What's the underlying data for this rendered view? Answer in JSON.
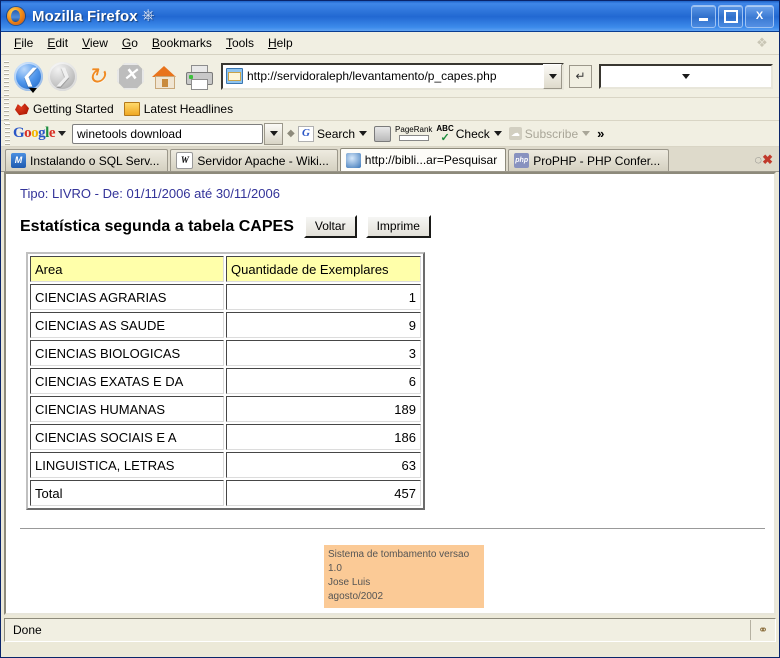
{
  "window": {
    "title": "Mozilla Firefox",
    "icon": "firefox-icon",
    "minimize_label": "Minimize",
    "maximize_label": "Maximize",
    "close_label": "X"
  },
  "menubar": {
    "items": [
      {
        "label": "File",
        "accel": "F"
      },
      {
        "label": "Edit",
        "accel": "E"
      },
      {
        "label": "View",
        "accel": "V"
      },
      {
        "label": "Go",
        "accel": "G"
      },
      {
        "label": "Bookmarks",
        "accel": "B"
      },
      {
        "label": "Tools",
        "accel": "T"
      },
      {
        "label": "Help",
        "accel": "H"
      }
    ]
  },
  "navbar": {
    "back_label": "Back",
    "forward_label": "Forward",
    "reload_label": "Reload",
    "stop_label": "Stop",
    "home_label": "Home",
    "print_label": "Print",
    "url": "http://servidoraleph/levantamento/p_capes.php",
    "go_label": "Go",
    "search_value": ""
  },
  "bookmarks": {
    "items": [
      {
        "label": "Getting Started",
        "icon": "firefox-bookmark-icon"
      },
      {
        "label": "Latest Headlines",
        "icon": "folder-icon"
      }
    ]
  },
  "google_toolbar": {
    "logo": "Google",
    "query": "winetools download",
    "search_label": "Search",
    "pagerank_label": "PageRank",
    "check_label": "Check",
    "check_abc": "ABC",
    "subscribe_label": "Subscribe",
    "more_label": "»"
  },
  "tabs": [
    {
      "label": "Instalando o SQL Serv...",
      "icon": "sql-icon",
      "active": false
    },
    {
      "label": "Servidor Apache - Wiki...",
      "icon": "wikipedia-icon",
      "active": false
    },
    {
      "label": "http://bibli...ar=Pesquisar",
      "icon": "globe-icon",
      "active": true
    },
    {
      "label": "ProPHP - PHP Confer...",
      "icon": "php-icon",
      "active": false
    }
  ],
  "page": {
    "subtitle": "Tipo: LIVRO - De: 01/11/2006 até 30/11/2006",
    "headline": "Estatística segunda a tabela CAPES",
    "buttons": [
      {
        "label": "Voltar"
      },
      {
        "label": "Imprime"
      }
    ],
    "table": {
      "headers": [
        "Area",
        "Quantidade de Exemplares"
      ],
      "rows": [
        {
          "area": "CIENCIAS AGRARIAS",
          "qtd": "1"
        },
        {
          "area": "CIENCIAS AS SAUDE",
          "qtd": "9"
        },
        {
          "area": "CIENCIAS BIOLOGICAS",
          "qtd": "3"
        },
        {
          "area": "CIENCIAS EXATAS E DA",
          "qtd": "6"
        },
        {
          "area": "CIENCIAS HUMANAS",
          "qtd": "189"
        },
        {
          "area": "CIENCIAS SOCIAIS E A",
          "qtd": "186"
        },
        {
          "area": "LINGUISTICA, LETRAS",
          "qtd": "63"
        },
        {
          "area": "Total",
          "qtd": "457"
        }
      ]
    },
    "footer": {
      "line1": "Sistema de tombamento versao 1.0",
      "line2": "Jose Luis",
      "line3": "agosto/2002",
      "bg_color": "#fbca96"
    }
  },
  "statusbar": {
    "text": "Done",
    "security_icon": "security-icon"
  },
  "colors": {
    "titlebar_blue": "#2268d2",
    "table_header_yellow": "#ffffaa",
    "subtitle_blue": "#333399",
    "footer_orange": "#fbca96"
  }
}
